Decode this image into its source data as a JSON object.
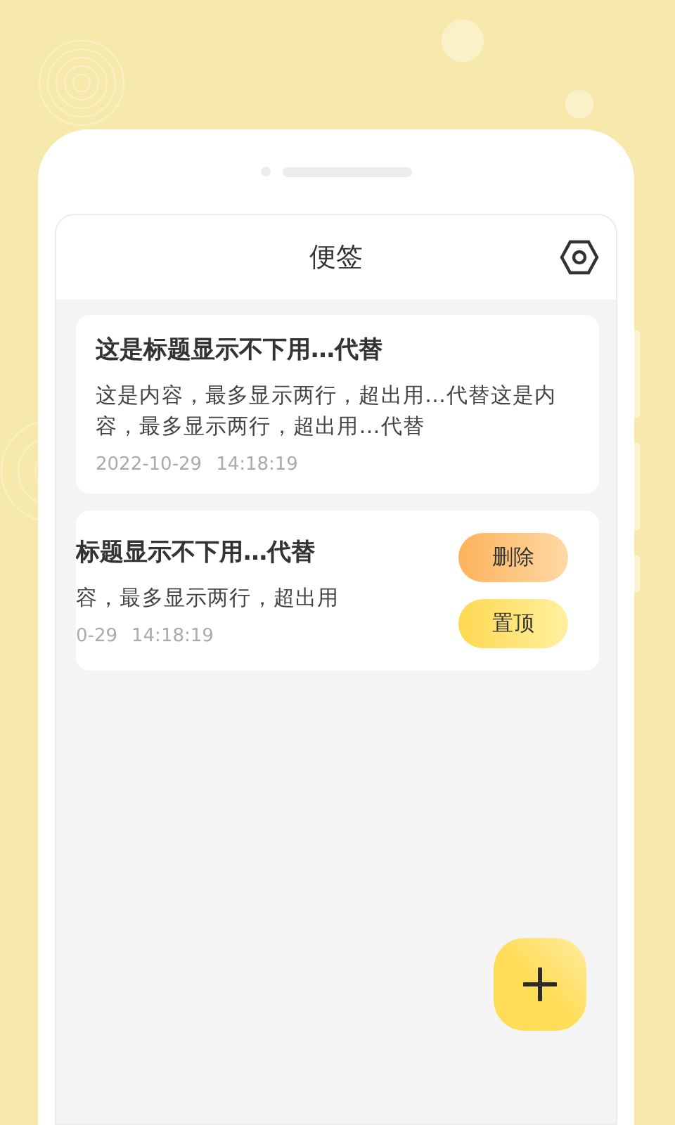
{
  "app": {
    "title": "便签"
  },
  "notes": [
    {
      "title": "这是标题显示不下用…代替",
      "content": "这是内容，最多显示两行，超出用…代替这是内容，最多显示两行，超出用…代替",
      "date": "2022-10-29",
      "time": "14:18:19",
      "swiped": false
    },
    {
      "title": "标题显示不下用…代替",
      "content": "容，最多显示两行，超出用",
      "date": "0-29",
      "time": "14:18:19",
      "swiped": true,
      "actions": [
        {
          "label": "删除",
          "kind": "delete"
        },
        {
          "label": "置顶",
          "kind": "pin"
        }
      ]
    }
  ]
}
